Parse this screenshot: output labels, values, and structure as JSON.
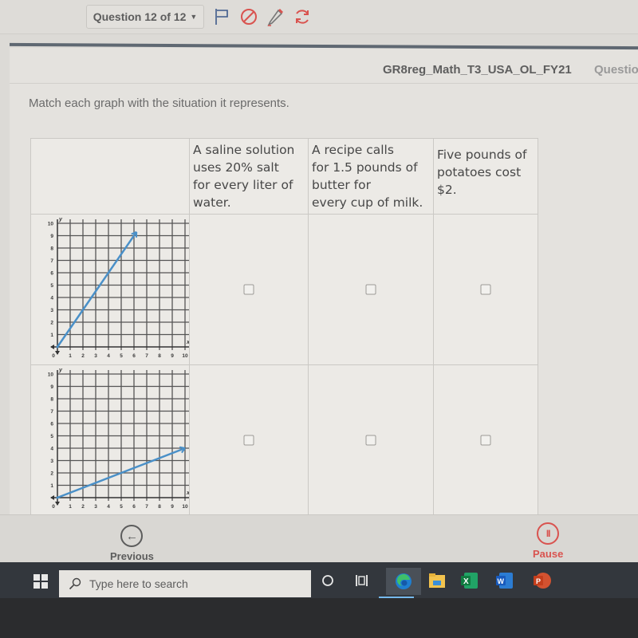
{
  "header": {
    "question_selector": "Question 12 of 12",
    "icons": [
      "flag-icon",
      "cancel-icon",
      "pencil-icon",
      "refresh-icon"
    ],
    "test_name": "GR8reg_Math_T3_USA_OL_FY21",
    "question_label": "Questio"
  },
  "prompt": "Match each graph with the situation it represents.",
  "table": {
    "columns": [
      {
        "lines": [
          "A saline solution",
          "uses 20% salt",
          "for every liter of",
          "water."
        ]
      },
      {
        "lines": [
          "A recipe calls",
          "for 1.5 pounds of",
          "butter for",
          "every cup of milk."
        ]
      },
      {
        "lines": [
          "Five pounds of",
          "potatoes cost",
          "$2."
        ]
      }
    ],
    "rows": [
      {
        "graph_index": 0,
        "checked": [
          false,
          false,
          false
        ]
      },
      {
        "graph_index": 1,
        "checked": [
          false,
          false,
          false
        ]
      }
    ]
  },
  "chart_data": [
    {
      "type": "line",
      "title": "",
      "xlabel": "x",
      "ylabel": "y",
      "xlim": [
        0,
        10
      ],
      "ylim": [
        0,
        10
      ],
      "x_ticks": [
        "0",
        "1",
        "2",
        "3",
        "4",
        "5",
        "6",
        "7",
        "8",
        "9",
        "10"
      ],
      "y_ticks": [
        "1",
        "2",
        "3",
        "4",
        "5",
        "6",
        "7",
        "8",
        "9",
        "10"
      ],
      "grid": true,
      "series": [
        {
          "name": "line",
          "color": "#4a90c8",
          "x": [
            0,
            6.2
          ],
          "y": [
            0,
            9.3
          ],
          "slope": 1.5
        }
      ]
    },
    {
      "type": "line",
      "title": "",
      "xlabel": "x",
      "ylabel": "y",
      "xlim": [
        0,
        10
      ],
      "ylim": [
        0,
        10
      ],
      "x_ticks": [
        "0",
        "1",
        "2",
        "3",
        "4",
        "5",
        "6",
        "7",
        "8",
        "9",
        "10"
      ],
      "y_ticks": [
        "1",
        "2",
        "3",
        "4",
        "5",
        "6",
        "7",
        "8",
        "9",
        "10"
      ],
      "grid": true,
      "series": [
        {
          "name": "line",
          "color": "#4a90c8",
          "x": [
            0,
            10
          ],
          "y": [
            0,
            4
          ],
          "slope": 0.4
        }
      ]
    }
  ],
  "nav": {
    "previous_label": "Previous",
    "pause_label": "Pause",
    "previous_icon": "arrow-left-icon",
    "pause_icon": "pause-icon"
  },
  "taskbar": {
    "search_placeholder": "Type here to search",
    "apps": [
      "cortana",
      "task-view",
      "edge",
      "file-explorer",
      "excel",
      "word",
      "powerpoint"
    ]
  },
  "colors": {
    "accent_red": "#d9534f",
    "flag_blue": "#3d5a8a",
    "line_blue": "#4a90c8"
  }
}
